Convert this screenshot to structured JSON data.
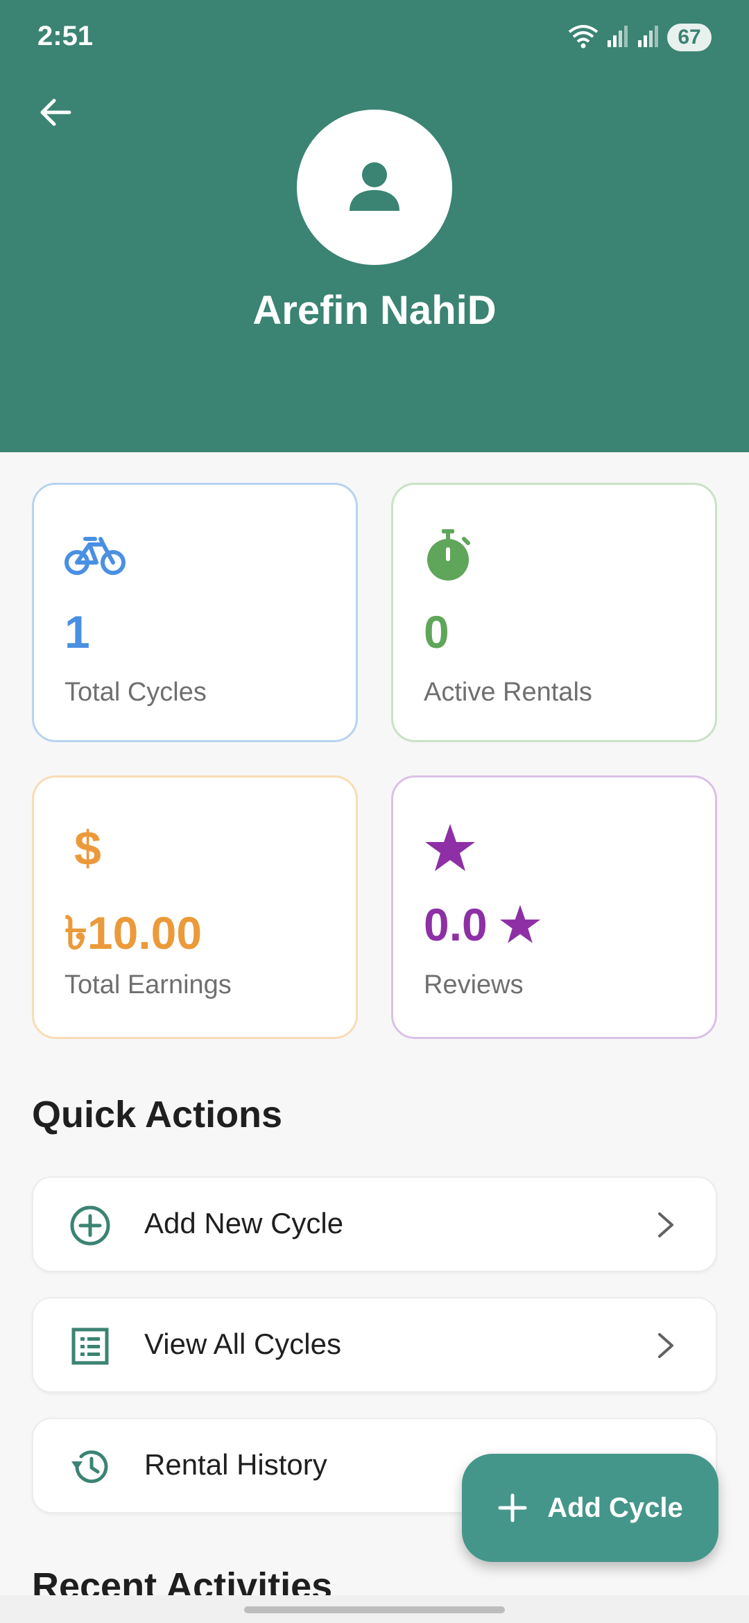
{
  "status_bar": {
    "time": "2:51",
    "battery": "67"
  },
  "profile": {
    "name": "Arefin NahiD"
  },
  "stats": [
    {
      "label": "Total Cycles",
      "value": "1",
      "color": "#4a90e2",
      "icon": "bicycle-icon"
    },
    {
      "label": "Active Rentals",
      "value": "0",
      "color": "#5fa55a",
      "icon": "timer-icon"
    },
    {
      "label": "Total Earnings",
      "value": "৳10.00",
      "color": "#eb9a3a",
      "icon": "dollar-icon"
    },
    {
      "label": "Reviews",
      "value": "0.0",
      "color": "#8e2fa6",
      "icon": "star-icon"
    }
  ],
  "quick_actions": {
    "title": "Quick Actions",
    "items": [
      {
        "label": "Add New Cycle",
        "icon": "add-circle-icon"
      },
      {
        "label": "View All Cycles",
        "icon": "list-icon"
      },
      {
        "label": "Rental History",
        "icon": "history-icon"
      }
    ]
  },
  "recent_activities": {
    "title": "Recent Activities"
  },
  "fab": {
    "label": "Add Cycle",
    "icon": "plus-icon"
  },
  "colors": {
    "primary": "#3b8373",
    "fab": "#45968a"
  }
}
